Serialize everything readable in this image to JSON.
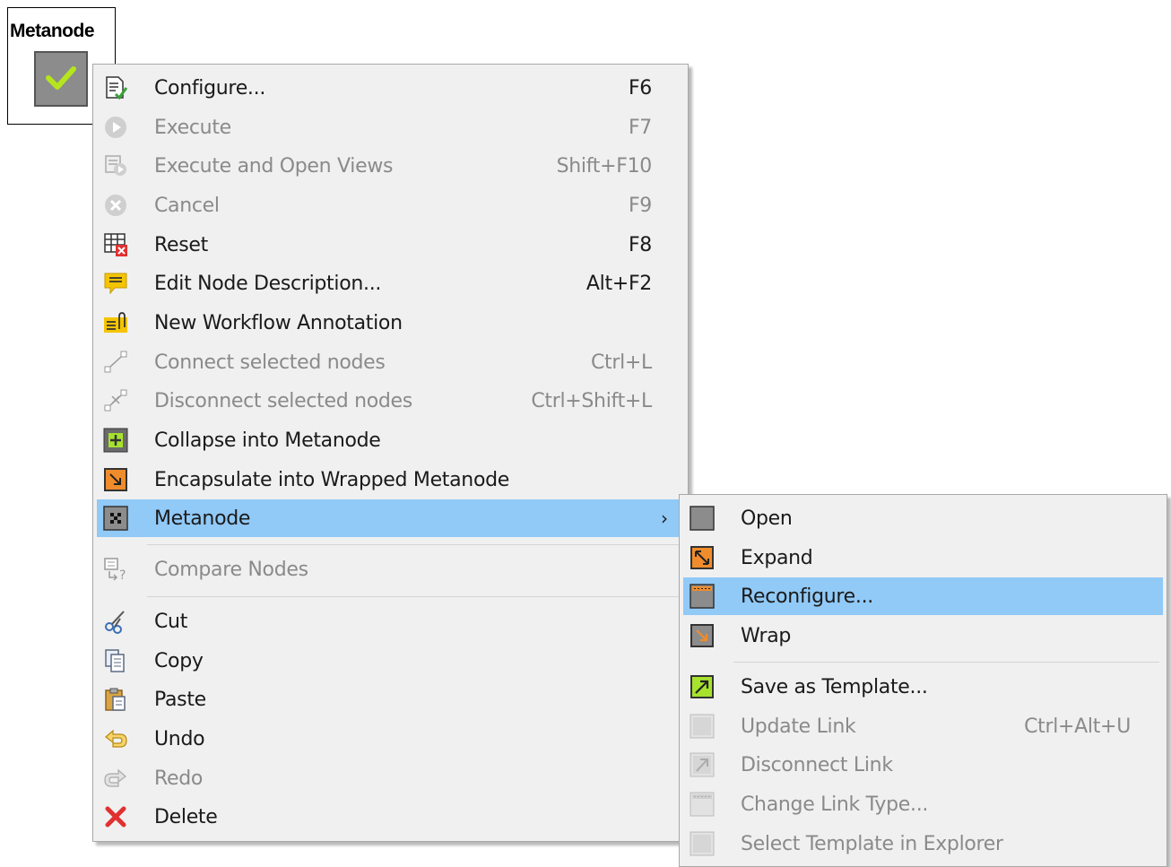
{
  "node": {
    "title": "Metanode"
  },
  "context_menu": {
    "items": [
      {
        "label": "Configure...",
        "shortcut": "F6",
        "icon": "configure-icon",
        "disabled": false
      },
      {
        "label": "Execute",
        "shortcut": "F7",
        "icon": "execute-icon",
        "disabled": true
      },
      {
        "label": "Execute and Open Views",
        "shortcut": "Shift+F10",
        "icon": "execute-open-views-icon",
        "disabled": true
      },
      {
        "label": "Cancel",
        "shortcut": "F9",
        "icon": "cancel-icon",
        "disabled": true
      },
      {
        "label": "Reset",
        "shortcut": "F8",
        "icon": "reset-icon",
        "disabled": false
      },
      {
        "label": "Edit Node Description...",
        "shortcut": "Alt+F2",
        "icon": "edit-description-icon",
        "disabled": false
      },
      {
        "label": "New Workflow Annotation",
        "shortcut": "",
        "icon": "annotation-icon",
        "disabled": false
      },
      {
        "label": "Connect selected nodes",
        "shortcut": "Ctrl+L",
        "icon": "connect-nodes-icon",
        "disabled": true
      },
      {
        "label": "Disconnect selected nodes",
        "shortcut": "Ctrl+Shift+L",
        "icon": "disconnect-nodes-icon",
        "disabled": true
      },
      {
        "label": "Collapse into Metanode",
        "shortcut": "",
        "icon": "collapse-icon",
        "disabled": false
      },
      {
        "label": "Encapsulate into Wrapped Metanode",
        "shortcut": "",
        "icon": "encapsulate-icon",
        "disabled": false
      },
      {
        "label": "Metanode",
        "shortcut": "",
        "icon": "metanode-icon",
        "disabled": false
      },
      {
        "label": "Compare Nodes",
        "shortcut": "",
        "icon": "compare-nodes-icon",
        "disabled": true
      },
      {
        "label": "Cut",
        "shortcut": "",
        "icon": "cut-icon",
        "disabled": false
      },
      {
        "label": "Copy",
        "shortcut": "",
        "icon": "copy-icon",
        "disabled": false
      },
      {
        "label": "Paste",
        "shortcut": "",
        "icon": "paste-icon",
        "disabled": false
      },
      {
        "label": "Undo",
        "shortcut": "",
        "icon": "undo-icon",
        "disabled": false
      },
      {
        "label": "Redo",
        "shortcut": "",
        "icon": "redo-icon",
        "disabled": true
      },
      {
        "label": "Delete",
        "shortcut": "",
        "icon": "delete-icon",
        "disabled": false
      }
    ]
  },
  "submenu": {
    "items": [
      {
        "label": "Open",
        "shortcut": "",
        "icon": "open-icon",
        "disabled": false
      },
      {
        "label": "Expand",
        "shortcut": "",
        "icon": "expand-icon",
        "disabled": false
      },
      {
        "label": "Reconfigure...",
        "shortcut": "",
        "icon": "reconfigure-icon",
        "disabled": false
      },
      {
        "label": "Wrap",
        "shortcut": "",
        "icon": "wrap-icon",
        "disabled": false
      },
      {
        "label": "Save as Template...",
        "shortcut": "",
        "icon": "save-template-icon",
        "disabled": false
      },
      {
        "label": "Update Link",
        "shortcut": "Ctrl+Alt+U",
        "icon": "update-link-icon",
        "disabled": true
      },
      {
        "label": "Disconnect Link",
        "shortcut": "",
        "icon": "disconnect-link-icon",
        "disabled": true
      },
      {
        "label": "Change Link Type...",
        "shortcut": "",
        "icon": "change-link-type-icon",
        "disabled": true
      },
      {
        "label": "Select Template in Explorer",
        "shortcut": "",
        "icon": "select-template-icon",
        "disabled": true
      }
    ]
  },
  "colors": {
    "highlight": "#91c9f7",
    "menu_bg": "#f0f0f0",
    "disabled_text": "#8a8a8a",
    "node_ok": "#a6e22e"
  }
}
